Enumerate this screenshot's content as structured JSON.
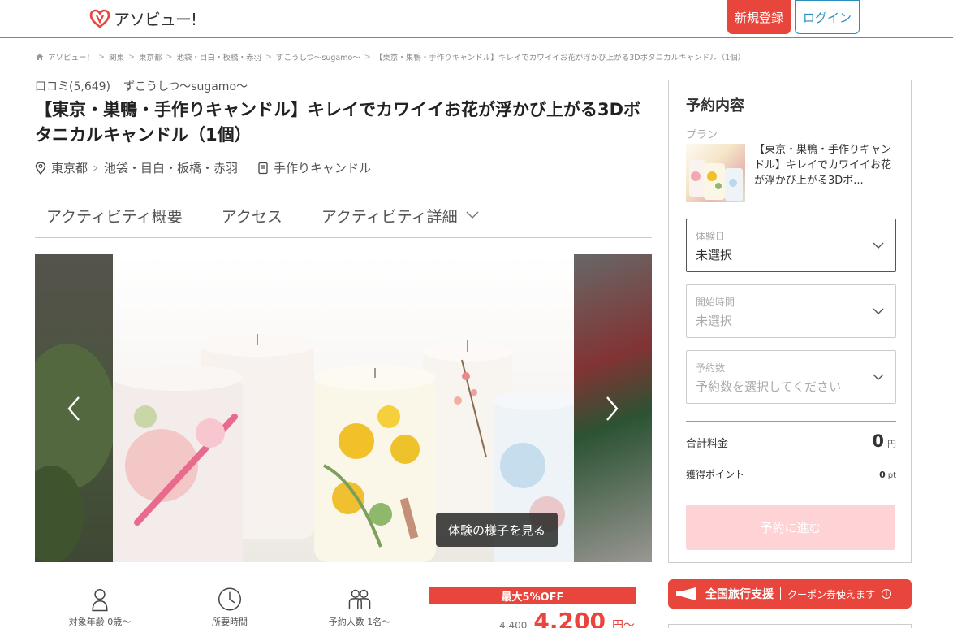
{
  "header": {
    "logo_text": "アソビュー!",
    "register_label": "新規登録",
    "login_label": "ログイン",
    "brand_color": "#e8463c",
    "login_color": "#2a8fbd"
  },
  "breadcrumb": {
    "items": [
      "アソビュー！",
      "関東",
      "東京都",
      "池袋・目白・板橋・赤羽",
      "ずこうしつ〜sugamo〜",
      "【東京・巣鴨・手作りキャンドル】キレイでカワイイお花が浮かび上がる3Dボタニカルキャンドル（1個）"
    ],
    "separator": ">"
  },
  "activity": {
    "reviews": "口コミ(5,649)",
    "shop_name": "ずこうしつ〜sugamo〜",
    "title": "【東京・巣鴨・手作りキャンドル】キレイでカワイイお花が浮かび上がる3Dボタニカルキャンドル（1個）",
    "area_pref": "東京都",
    "area_sub": "池袋・目白・板橋・赤羽",
    "category": "手作りキャンドル"
  },
  "tabs": [
    {
      "label": "アクティビティ概要"
    },
    {
      "label": "アクセス"
    },
    {
      "label": "アクティビティ詳細"
    }
  ],
  "carousel": {
    "view_button": "体験の様子を見る"
  },
  "info_icons": [
    {
      "icon": "person-icon",
      "label": "対象年齢 0歳〜"
    },
    {
      "icon": "clock-icon",
      "label": "所要時間"
    },
    {
      "icon": "group-icon",
      "label": "予約人数 1名〜"
    }
  ],
  "price": {
    "discount": "最大5%OFF",
    "old_price": "4,400",
    "new_price": "4,200",
    "unit": "円〜"
  },
  "booking": {
    "title": "予約内容",
    "plan_label": "プラン",
    "plan_text": "【東京・巣鴨・手作りキャンドル】キレイでカワイイお花が浮かび上がる3Dボ...",
    "date": {
      "label": "体験日",
      "value": "未選択"
    },
    "time": {
      "label": "開始時間",
      "value": "未選択"
    },
    "count": {
      "label": "予約数",
      "value": "予約数を選択してください"
    },
    "total_label": "合計料金",
    "total_value": "0",
    "total_unit": "円",
    "points_label": "獲得ポイント",
    "points_value": "0",
    "points_unit": "pt",
    "reserve_button": "予約に進む"
  },
  "travel_banner": {
    "main": "全国旅行支援",
    "sub": "クーポン券使えます",
    "info": "i"
  }
}
